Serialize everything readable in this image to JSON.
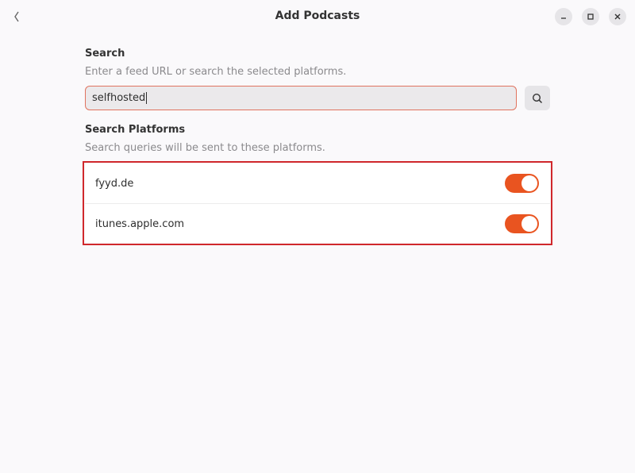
{
  "window": {
    "title": "Add Podcasts",
    "back_icon": "chevron-left-icon",
    "minimize_icon": "minimize-icon",
    "maximize_icon": "maximize-icon",
    "close_icon": "close-icon"
  },
  "search": {
    "heading": "Search",
    "subtitle": "Enter a feed URL or search the selected platforms.",
    "value": "selfhosted",
    "button_icon": "search-icon"
  },
  "platforms": {
    "heading": "Search Platforms",
    "subtitle": "Search queries will be sent to these platforms.",
    "items": [
      {
        "label": "fyyd.de",
        "enabled": true
      },
      {
        "label": "itunes.apple.com",
        "enabled": true
      }
    ]
  },
  "colors": {
    "accent": "#e95420",
    "focus_border": "#e0735f",
    "highlight_outline": "#d0282c"
  }
}
